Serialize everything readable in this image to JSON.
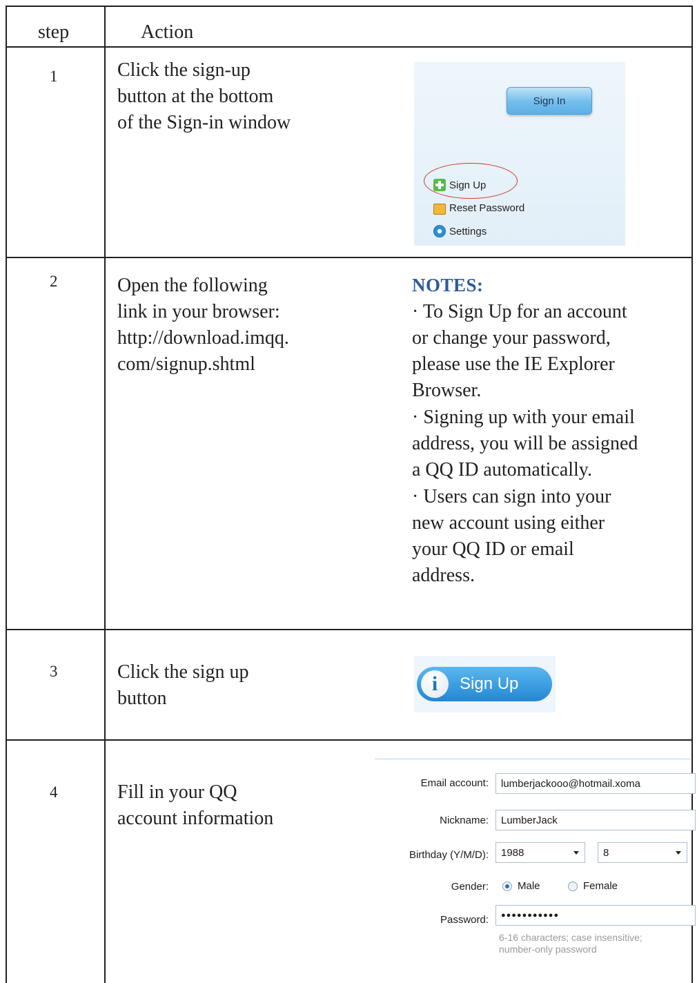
{
  "table": {
    "header": {
      "step": "step",
      "action": "Action"
    },
    "rows": [
      {
        "step": "1",
        "action": "Click the sign-up\nbutton at the bottom\nof the Sign-in window"
      },
      {
        "step": "2",
        "action": "Open the following\nlink in your browser:\nhttp://download.imqq.\ncom/signup.shtml"
      },
      {
        "step": "3",
        "action": "Click the sign up\nbutton"
      },
      {
        "step": "4",
        "action": "Fill in your QQ\naccount information"
      }
    ]
  },
  "step1_screenshot": {
    "sign_in_button": "Sign In",
    "sign_up_link": "Sign Up",
    "reset_password_link": "Reset Password",
    "settings_link": "Settings",
    "highlight_color": "#d2392e"
  },
  "notes": {
    "title": "NOTES:",
    "items": [
      "· To Sign Up for an account\nor change your password,\nplease use the IE Explorer\nBrowser.",
      "· Signing up with your email\naddress, you will be assigned\na QQ ID automatically.",
      "· Users can sign into your\nnew account using either\nyour QQ ID or email\naddress."
    ],
    "title_color": "#2e5a9c"
  },
  "step3_button": {
    "label": "Sign Up",
    "icon": "info-icon"
  },
  "step4_form": {
    "email_label": "Email account:",
    "email_value": "lumberjackooo@hotmail.xoma",
    "nickname_label": "Nickname:",
    "nickname_value": "LumberJack",
    "birthday_label": "Birthday (Y/M/D):",
    "birthday_year": "1988",
    "birthday_month": "8",
    "gender_label": "Gender:",
    "gender_male": "Male",
    "gender_female": "Female",
    "gender_selected": "Male",
    "password_label": "Password:",
    "password_value": "●●●●●●●●●●●",
    "password_hint": "6-16 characters; case insensitive;\nnumber-only password"
  }
}
